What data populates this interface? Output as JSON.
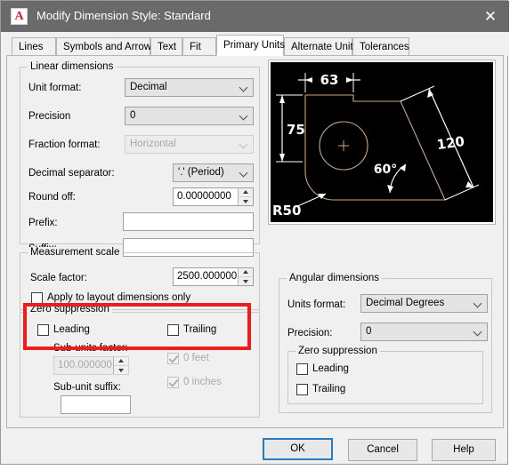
{
  "window": {
    "title": "Modify Dimension Style: Standard",
    "logo_glyph": "A",
    "close_glyph": "✕"
  },
  "tabs": [
    {
      "label": "Lines",
      "active": false
    },
    {
      "label": "Symbols and Arrows",
      "active": false
    },
    {
      "label": "Text",
      "active": false
    },
    {
      "label": "Fit",
      "active": false
    },
    {
      "label": "Primary Units",
      "active": true
    },
    {
      "label": "Alternate Units",
      "active": false
    },
    {
      "label": "Tolerances",
      "active": false
    }
  ],
  "linear_dimensions": {
    "legend": "Linear dimensions",
    "unit_format_label": "Unit format:",
    "unit_format_value": "Decimal",
    "precision_label": "Precision",
    "precision_value": "0",
    "fraction_format_label": "Fraction format:",
    "fraction_format_value": "Horizontal",
    "decimal_separator_label": "Decimal separator:",
    "decimal_separator_value": "'.' (Period)",
    "round_off_label": "Round off:",
    "round_off_value": "0.00000000",
    "prefix_label": "Prefix:",
    "prefix_value": "",
    "suffix_label": "Suffix:",
    "suffix_value": ""
  },
  "measurement_scale": {
    "legend": "Measurement scale",
    "scale_factor_label": "Scale factor:",
    "scale_factor_value": "2500.000000",
    "apply_layout_label": "Apply to layout dimensions only",
    "highlight_color": "#ee1c1c"
  },
  "zero_suppression_linear": {
    "legend": "Zero suppression",
    "leading_label": "Leading",
    "trailing_label": "Trailing",
    "sub_units_factor_label": "Sub-units factor:",
    "sub_units_factor_value": "100.0000000",
    "sub_unit_suffix_label": "Sub-unit suffix:",
    "sub_unit_suffix_value": "",
    "zero_feet_label": "0 feet",
    "zero_inches_label": "0 inches"
  },
  "angular_dimensions": {
    "legend": "Angular dimensions",
    "units_format_label": "Units format:",
    "units_format_value": "Decimal Degrees",
    "precision_label": "Precision:",
    "precision_value": "0",
    "zero_suppression_legend": "Zero suppression",
    "leading_label": "Leading",
    "trailing_label": "Trailing"
  },
  "preview": {
    "dim_width": "63",
    "dim_height": "75",
    "dim_slant": "120",
    "dim_angle": "60°",
    "dim_radius": "R50",
    "background": "#000000",
    "geometry_color": "#c8a882",
    "annotation_color": "#ffffff"
  },
  "footer": {
    "ok_label": "OK",
    "cancel_label": "Cancel",
    "help_label": "Help"
  }
}
